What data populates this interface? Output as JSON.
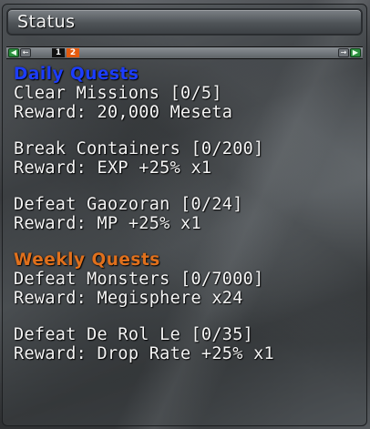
{
  "window": {
    "title": "Status"
  },
  "tabs": {
    "items": [
      {
        "label": "1",
        "active": false
      },
      {
        "label": "2",
        "active": true
      }
    ],
    "left_end_icon": "left-end-arrow-icon",
    "left_icon": "left-arrow-icon",
    "right_icon": "right-arrow-icon",
    "right_end_icon": "right-end-arrow-icon"
  },
  "colors": {
    "daily_heading": "#1c3dff",
    "weekly_heading": "#e0701c",
    "active_tab": "#e45a0e",
    "text": "#f4f4f4"
  },
  "daily": {
    "heading": "Daily Quests",
    "quests": [
      {
        "name": "Clear Missions [0/5]",
        "reward": "Reward: 20,000 Meseta"
      },
      {
        "name": "Break Containers [0/200]",
        "reward": "Reward: EXP +25% x1"
      },
      {
        "name": "Defeat Gaozoran [0/24]",
        "reward": "Reward: MP +25% x1"
      }
    ]
  },
  "weekly": {
    "heading": "Weekly Quests",
    "quests": [
      {
        "name": "Defeat Monsters [0/7000]",
        "reward": "Reward: Megisphere x24"
      },
      {
        "name": "Defeat De Rol Le [0/35]",
        "reward": "Reward: Drop Rate +25% x1"
      }
    ]
  }
}
